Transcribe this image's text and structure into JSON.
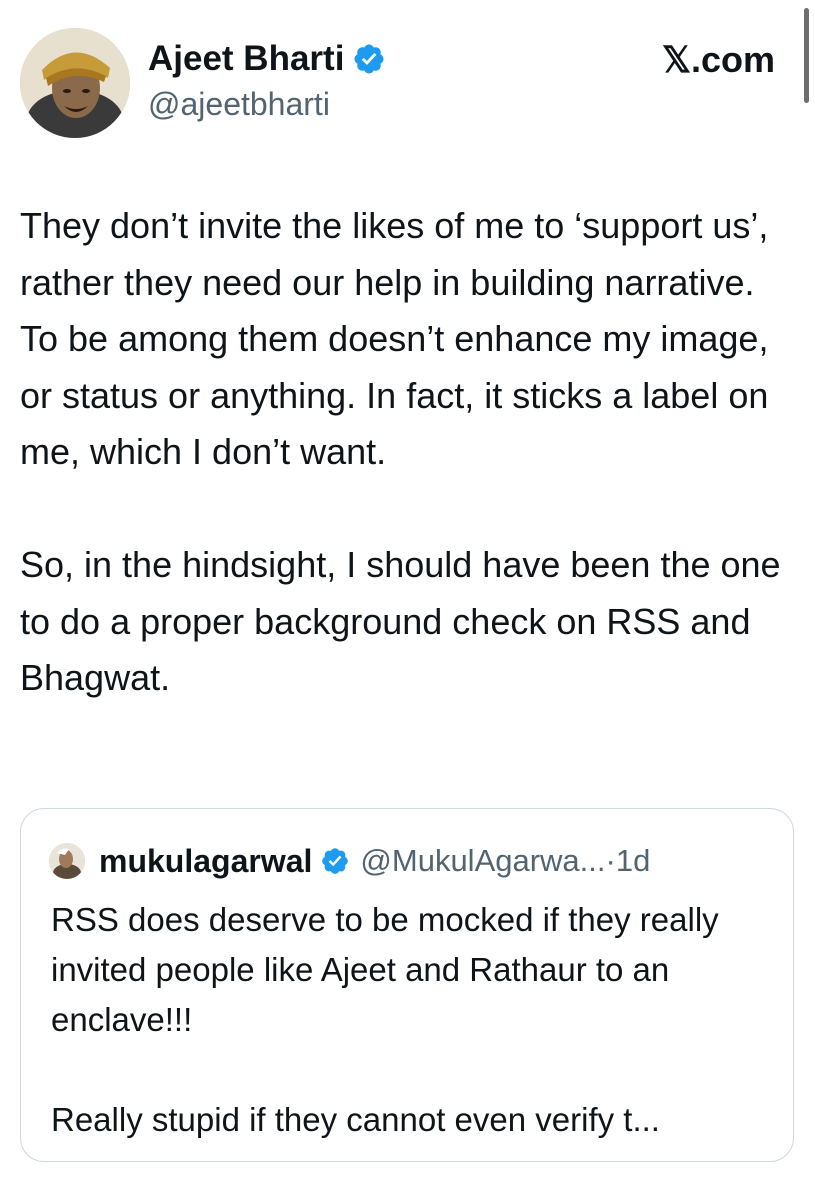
{
  "source": {
    "label": "𝕏.com"
  },
  "author": {
    "name": "Ajeet Bharti",
    "handle": "@ajeetbharti",
    "verified": true
  },
  "tweet": {
    "paragraphs": [
      "They don’t invite the likes of me to ‘support us’, rather they need our help in building narrative. To be among them doesn’t enhance my image, or status or anything. In fact, it sticks a label on me, which I don’t want.",
      "So, in the hindsight, I should have been the one to do a proper background check on RSS and Bhagwat."
    ]
  },
  "quoted_tweet": {
    "name": "mukulagarwal",
    "handle": "@MukulAgarwa...",
    "time_separator": "·",
    "time": "1d",
    "verified": true,
    "paragraphs": [
      "RSS does deserve to be mocked if they really invited people like Ajeet and Rathaur to an enclave!!!",
      "Really stupid if they cannot even verify  t..."
    ]
  },
  "colors": {
    "text": "#0f1419",
    "secondary": "#536471",
    "verified_badge": "#1d9bf0",
    "border": "#cfd9de"
  }
}
